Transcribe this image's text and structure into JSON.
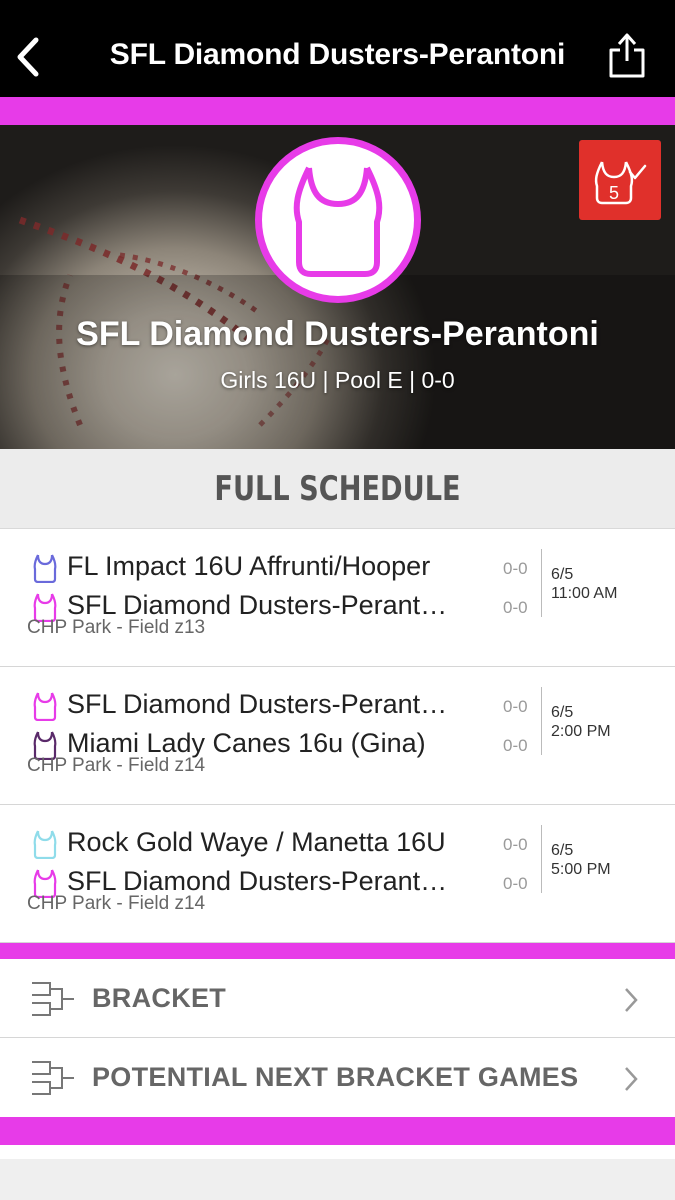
{
  "nav": {
    "title": "SFL Diamond Dusters-Perantoni",
    "back_icon": "chevron-left-icon",
    "share_icon": "share-icon"
  },
  "colors": {
    "accent": "#e73be8",
    "badge_red": "#e0302b",
    "jersey_magenta": "#e73be8",
    "jersey_purple": "#6a6adb",
    "jersey_dark_purple": "#5a2a6a",
    "jersey_light_blue": "#8fdcea"
  },
  "hero": {
    "team_name": "SFL Diamond Dusters-Perantoni",
    "subtitle": "Girls 16U | Pool E | 0-0",
    "badge_icon": "jersey-icon",
    "favorite_icon": "jersey-check-icon",
    "favorite_number": "5"
  },
  "schedule": {
    "header": "FULL SCHEDULE",
    "games": [
      {
        "team1": "FL Impact 16U Affrunti/Hooper",
        "team1_score": "0-0",
        "team1_color": "#6a6adb",
        "team2": "SFL Diamond Dusters-Perantoni",
        "team2_score": "0-0",
        "team2_color": "#e73be8",
        "venue": "CHP Park - Field z13",
        "date": "6/5",
        "time": "11:00 AM"
      },
      {
        "team1": "SFL Diamond Dusters-Perantoni",
        "team1_score": "0-0",
        "team1_color": "#e73be8",
        "team2": "Miami Lady Canes 16u (Gina)",
        "team2_score": "0-0",
        "team2_color": "#5a2a6a",
        "venue": "CHP Park - Field z14",
        "date": "6/5",
        "time": "2:00 PM"
      },
      {
        "team1": "Rock Gold Waye / Manetta 16U",
        "team1_score": "0-0",
        "team1_color": "#8fdcea",
        "team2": "SFL Diamond Dusters-Perantoni",
        "team2_score": "0-0",
        "team2_color": "#e73be8",
        "venue": "CHP Park - Field z14",
        "date": "6/5",
        "time": "5:00 PM"
      }
    ]
  },
  "links": [
    {
      "label": "BRACKET",
      "icon": "bracket-icon"
    },
    {
      "label": "POTENTIAL NEXT BRACKET GAMES",
      "icon": "bracket-icon"
    }
  ]
}
